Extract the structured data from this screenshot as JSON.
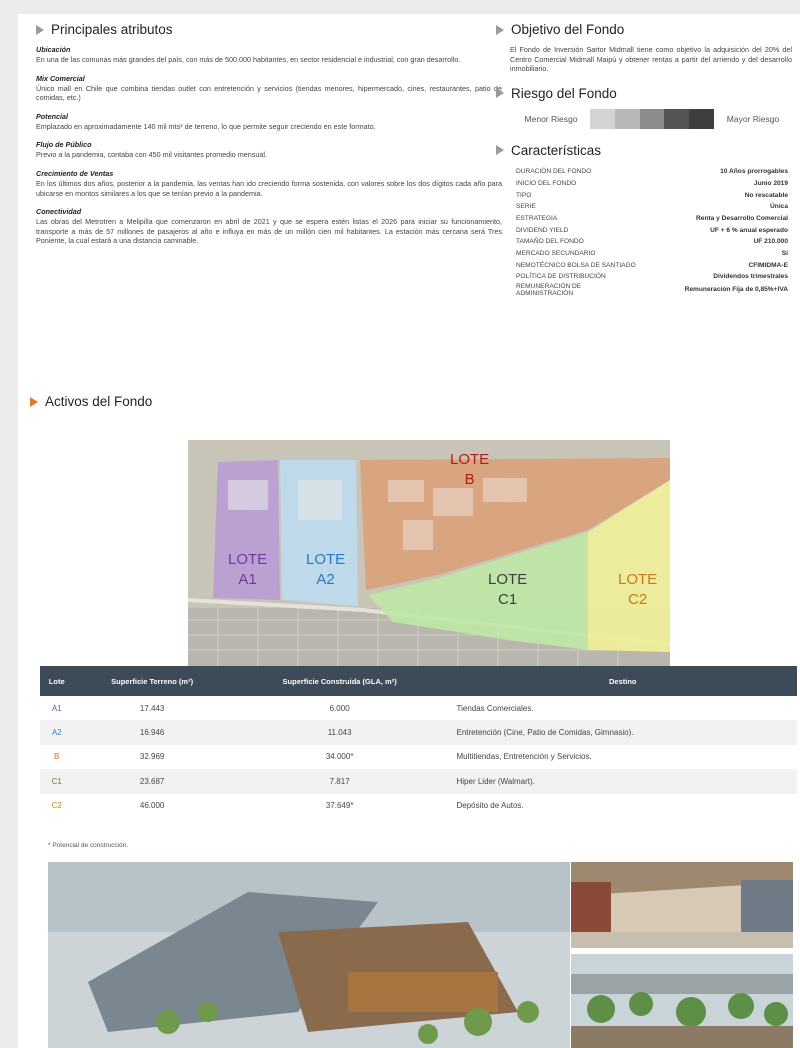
{
  "principales": {
    "title": "Principales atributos",
    "items": [
      {
        "title": "Ubicación",
        "text": "En una de las comunas más grandes del país, con más de 500.000 habitantes, en sector residencial e industrial, con gran desarrollo."
      },
      {
        "title": "Mix Comercial",
        "text": "Único mall en Chile que combina tiendas outlet con entretención y servicios (tiendas menores, hipermercado, cines, restaurantes, patio de comidas, etc.)"
      },
      {
        "title": "Potencial",
        "text": "Emplazado en aproximadamente 140 mil mts² de terreno, lo que permite  seguir creciendo en este formato."
      },
      {
        "title": "Flujo de Público",
        "text": "Previo a la pandemia, contaba con 450 mil visitantes promedio mensual."
      },
      {
        "title": "Crecimiento de Ventas",
        "text": "En los últimos dos años, posterior a la pandemia, las ventas han ido creciendo  forma sostenida, con valores sobre los dos dígitos cada año para ubicarse en montos similares a los que se tenían previo a la pandemia."
      },
      {
        "title": "Conectividad",
        "text": "Las obras del Metrotren a Melipilla que comenzaron en abril de 2021 y que se espera estén listas el 2026 para iniciar su funcionamiento, transporte a más de 57 millones de pasajeros al año e influya en más de un millón cien mil habitantes. La estación más cercana será Tres Poniente, la cual estará a una distancia caminable."
      }
    ]
  },
  "objetivo": {
    "title": "Objetivo del Fondo",
    "text": "El Fondo de Inversión Sartor Midmall tiene como objetivo la adquisición del 20% del Centro Comercial Midmall Maipú y obtener rentas a partir del arriendo y del desarrollo inmobiliario."
  },
  "riesgo": {
    "title": "Riesgo del Fondo",
    "menor": "Menor Riesgo",
    "mayor": "Mayor Riesgo",
    "colors": [
      "#d4d4d4",
      "#b8b8b8",
      "#8c8c8c",
      "#555555",
      "#3e3e3e"
    ]
  },
  "caracteristicas": {
    "title": "Características",
    "rows": [
      {
        "k": "DURACIÓN DEL FONDO",
        "v": "10 Años prorrogables"
      },
      {
        "k": "INICIO DEL FONDO",
        "v": "Junio 2019"
      },
      {
        "k": "TIPO",
        "v": "No rescatable"
      },
      {
        "k": "SERIE",
        "v": "Única"
      },
      {
        "k": "ESTRATEGIA",
        "v": "Renta y Desarrollo Comercial"
      },
      {
        "k": "DIVIDEND YIELD",
        "v": "UF + 6 % anual esperado"
      },
      {
        "k": "TAMAÑO DEL FONDO",
        "v": "UF 210.000"
      },
      {
        "k": "MERCADO SECUNDARIO",
        "v": "Sí"
      },
      {
        "k": "NEMOTÉCNICO BOLSA DE SANTIAGO",
        "v": "CFIMIDMA-E"
      },
      {
        "k": "POLÍTICA DE DISTRIBUCIÓN",
        "v": "Dividendos trimestrales"
      },
      {
        "k": "REMUNERACIÓN DE ADMINISTRACIÓN",
        "v": "Remuneración Fija de 0,85%+IVA"
      }
    ]
  },
  "activos": {
    "title": "Activos del Fondo"
  },
  "map": {
    "lotes": [
      {
        "l1": "LOTE",
        "l2": "A1",
        "color": "#6a3d9a"
      },
      {
        "l1": "LOTE",
        "l2": "A2",
        "color": "#2b78c2"
      },
      {
        "l1": "LOTE",
        "l2": "B",
        "color": "#b31b1b"
      },
      {
        "l1": "LOTE",
        "l2": "C1",
        "color": "#3f3f3f"
      },
      {
        "l1": "LOTE",
        "l2": "C2",
        "color": "#c9771d"
      }
    ]
  },
  "tabla": {
    "headers": [
      "Lote",
      "Superficie Terreno (m²)",
      "Superficie Construida  (GLA, m²)",
      "Destino"
    ],
    "rows": [
      {
        "lote": "A1",
        "color": "#7d4fa6",
        "terreno": "17.443",
        "construida": "6.000",
        "destino": "Tiendas Comerciales."
      },
      {
        "lote": "A2",
        "color": "#3a7fc4",
        "terreno": "16.946",
        "construida": "11.043",
        "destino": "Entretención (Cine, Patio de Comidas, Gimnasio)."
      },
      {
        "lote": "B",
        "color": "#e0701e",
        "terreno": "32.969",
        "construida": "34.000*",
        "destino": "Multitiendas, Entretención y Servicios."
      },
      {
        "lote": "C1",
        "color": "#4c8a3a",
        "terreno": "23.687",
        "construida": "7.817",
        "destino": "Hiper Lider (Walmart)."
      },
      {
        "lote": "C2",
        "color": "#c98a1d",
        "terreno": "46.000",
        "construida": "37.649*",
        "destino": "Depósito de Autos."
      }
    ],
    "footnote": "* Potencial de construcción."
  }
}
